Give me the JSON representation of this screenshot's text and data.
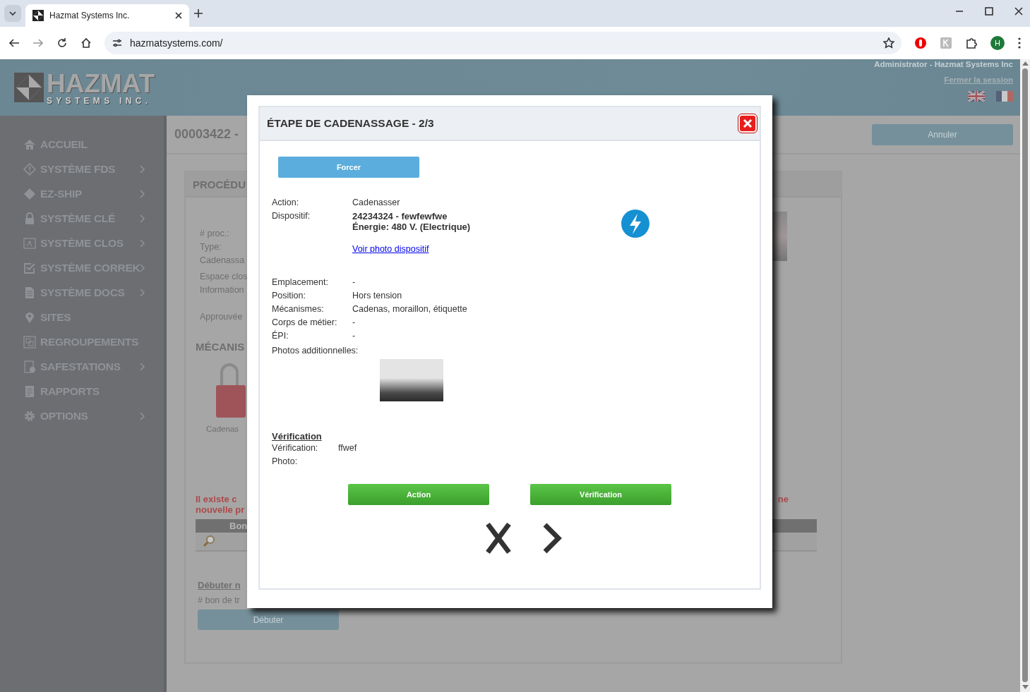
{
  "browser": {
    "tab_title": "Hazmat Systems Inc.",
    "url": "hazmatsystems.com/",
    "profile_initial": "H"
  },
  "header": {
    "logo_title": "HAZMAT",
    "logo_subtitle": "SYSTEMS INC.",
    "user": "Administrator - Hazmat Systems Inc",
    "logout": "Fermer la session"
  },
  "sidebar": {
    "items": [
      {
        "label": "ACCUEIL",
        "has_submenu": false
      },
      {
        "label": "SYSTÈME FDS",
        "has_submenu": true
      },
      {
        "label": "EZ-SHIP",
        "has_submenu": true
      },
      {
        "label": "SYSTÈME CLÉ",
        "has_submenu": true
      },
      {
        "label": "SYSTÈME CLOS",
        "has_submenu": true
      },
      {
        "label": "SYSTÈME CORREK",
        "has_submenu": true
      },
      {
        "label": "SYSTÈME DOCS",
        "has_submenu": true
      },
      {
        "label": "SITES",
        "has_submenu": false
      },
      {
        "label": "REGROUPEMENTS",
        "has_submenu": false
      },
      {
        "label": "SAFESTATIONS",
        "has_submenu": true
      },
      {
        "label": "RAPPORTS",
        "has_submenu": false
      },
      {
        "label": "OPTIONS",
        "has_submenu": true
      }
    ]
  },
  "page": {
    "title": "00003422 -",
    "cancel_button": "Annuler",
    "panel_title": "PROCÉDU",
    "info_lines": [
      "# proc.:",
      "Type:",
      "Cadenassa",
      "Espace clos",
      "Information"
    ],
    "approved": "Approuvée",
    "mechanisms_title": "MÉCANIS",
    "mechanism_label": "Cadenas",
    "warning_left": [
      "Il existe c",
      "nouvelle pr"
    ],
    "warning_right": "ne",
    "table_column": "Bon",
    "start_link": "Débuter n",
    "work_order_label": "# bon de tr",
    "start_button": "Débuter"
  },
  "dialog": {
    "title": "ÉTAPE DE CADENASSAGE - 2/3",
    "force_button": "Forcer",
    "action": {
      "label": "Action:",
      "value": "Cadenasser"
    },
    "device": {
      "label": "Dispositif:",
      "lines": [
        "24234324 - fewfewfwe",
        "Énergie: 480 V. (Electrique)"
      ],
      "photo_link": "Voir photo dispositif"
    },
    "details": [
      {
        "label": "Emplacement:",
        "value": "-"
      },
      {
        "label": "Position:",
        "value": "Hors tension"
      },
      {
        "label": "Mécanismes:",
        "value": "Cadenas, moraillon, étiquette"
      },
      {
        "label": "Corps de métier:",
        "value": "-"
      },
      {
        "label": "ÉPI:",
        "value": "-"
      }
    ],
    "photos_label": "Photos additionnelles:",
    "verification": {
      "heading": "Vérification",
      "fields": [
        {
          "label": "Vérification:",
          "value": "ffwef"
        },
        {
          "label": "Photo:"
        }
      ]
    },
    "buttons": [
      "Action",
      "Vérification"
    ]
  }
}
